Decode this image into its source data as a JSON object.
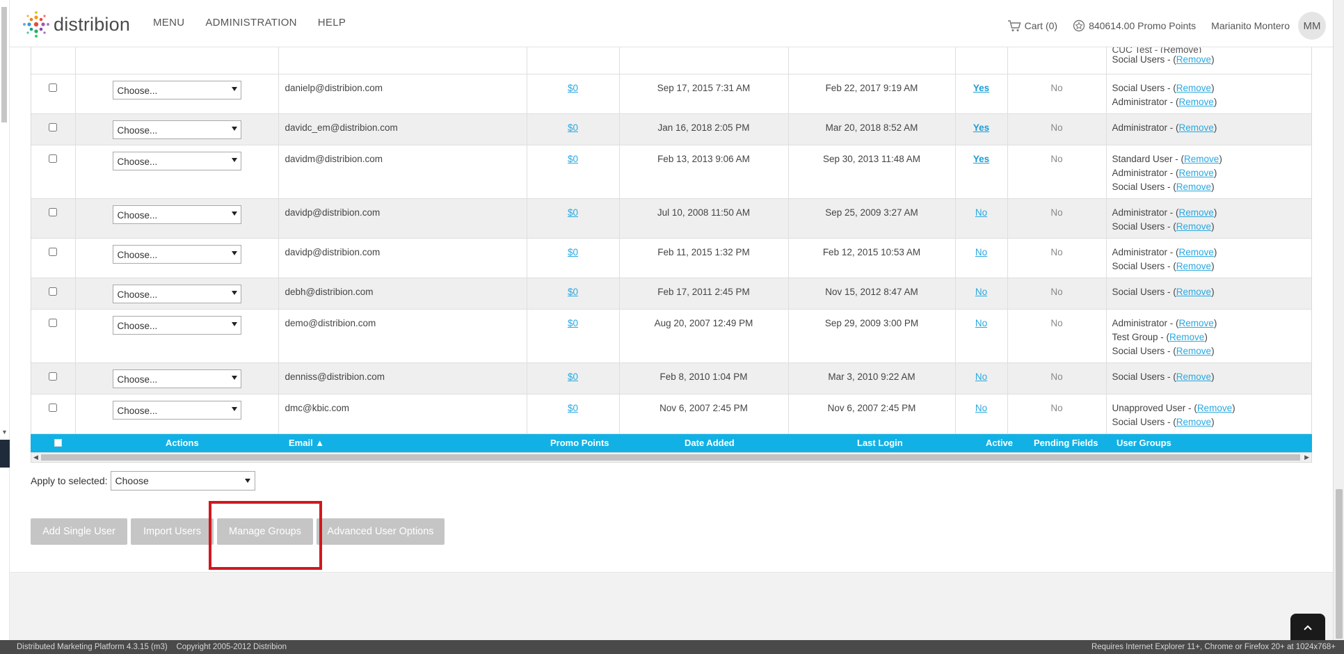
{
  "header": {
    "logo_text": "distribion",
    "nav": [
      "MENU",
      "ADMINISTRATION",
      "HELP"
    ],
    "cart": "Cart (0)",
    "points": "840614.00 Promo Points",
    "user_name": "Marianito Montero",
    "avatar_initials": "MM"
  },
  "top_partial": {
    "line1": "CUC Test - (Remove)",
    "group_line": "Social Users - ",
    "remove": "Remove"
  },
  "rows": [
    {
      "email": "danielp@distribion.com",
      "points": "$0",
      "added": "Sep 17, 2015 7:31 AM",
      "login": "Feb 22, 2017 9:19 AM",
      "active": "Yes",
      "pending": "No",
      "groups": [
        "Social Users - ",
        "Administrator - "
      ],
      "select": "Choose..."
    },
    {
      "email": "davidc_em@distribion.com",
      "points": "$0",
      "added": "Jan 16, 2018 2:05 PM",
      "login": "Mar 20, 2018 8:52 AM",
      "active": "Yes",
      "pending": "No",
      "groups": [
        "Administrator - "
      ],
      "select": "Choose..."
    },
    {
      "email": "davidm@distribion.com",
      "points": "$0",
      "added": "Feb 13, 2013 9:06 AM",
      "login": "Sep 30, 2013 11:48 AM",
      "active": "Yes",
      "pending": "No",
      "groups": [
        "Standard User - ",
        "Administrator - ",
        "Social Users - "
      ],
      "select": "Choose..."
    },
    {
      "email": "davidp@distribion.com",
      "points": "$0",
      "added": "Jul 10, 2008 11:50 AM",
      "login": "Sep 25, 2009 3:27 AM",
      "active": "No",
      "pending": "No",
      "groups": [
        "Administrator - ",
        "Social Users - "
      ],
      "select": "Choose..."
    },
    {
      "email": "davidp@distribion.com",
      "points": "$0",
      "added": "Feb 11, 2015 1:32 PM",
      "login": "Feb 12, 2015 10:53 AM",
      "active": "No",
      "pending": "No",
      "groups": [
        "Administrator - ",
        "Social Users - "
      ],
      "select": "Choose..."
    },
    {
      "email": "debh@distribion.com",
      "points": "$0",
      "added": "Feb 17, 2011 2:45 PM",
      "login": "Nov 15, 2012 8:47 AM",
      "active": "No",
      "pending": "No",
      "groups": [
        "Social Users - "
      ],
      "select": "Choose..."
    },
    {
      "email": "demo@distribion.com",
      "points": "$0",
      "added": "Aug 20, 2007 12:49 PM",
      "login": "Sep 29, 2009 3:00 PM",
      "active": "No",
      "pending": "No",
      "groups": [
        "Administrator - ",
        "Test Group - ",
        "Social Users - "
      ],
      "select": "Choose..."
    },
    {
      "email": "denniss@distribion.com",
      "points": "$0",
      "added": "Feb 8, 2010 1:04 PM",
      "login": "Mar 3, 2010 9:22 AM",
      "active": "No",
      "pending": "No",
      "groups": [
        "Social Users - "
      ],
      "select": "Choose..."
    },
    {
      "email": "dmc@kbic.com",
      "points": "$0",
      "added": "Nov 6, 2007 2:45 PM",
      "login": "Nov 6, 2007 2:45 PM",
      "active": "No",
      "pending": "No",
      "groups": [
        "Unapproved User - ",
        "Social Users - "
      ],
      "select": "Choose..."
    }
  ],
  "remove_label": "Remove",
  "columns": {
    "actions": "Actions",
    "email": "Email ▲",
    "points": "Promo Points",
    "added": "Date Added",
    "login": "Last Login",
    "active": "Active",
    "pending": "Pending Fields",
    "groups": "User Groups"
  },
  "apply": {
    "label": "Apply to selected:",
    "value": "Choose"
  },
  "buttons": {
    "add_single": "Add Single User",
    "import": "Import Users",
    "manage_groups": "Manage Groups",
    "advanced": "Advanced User Options"
  },
  "footer": {
    "left": "Distributed Marketing Platform 4.3.15 (m3)    Copyright 2005-2012 Distribion",
    "right": "Requires Internet Explorer 11+, Chrome or Firefox 20+ at 1024x768+"
  },
  "colors": {
    "accent": "#12b1e5",
    "link": "#29a8e0",
    "highlight": "#d0181e",
    "button": "#c5c5c5"
  }
}
